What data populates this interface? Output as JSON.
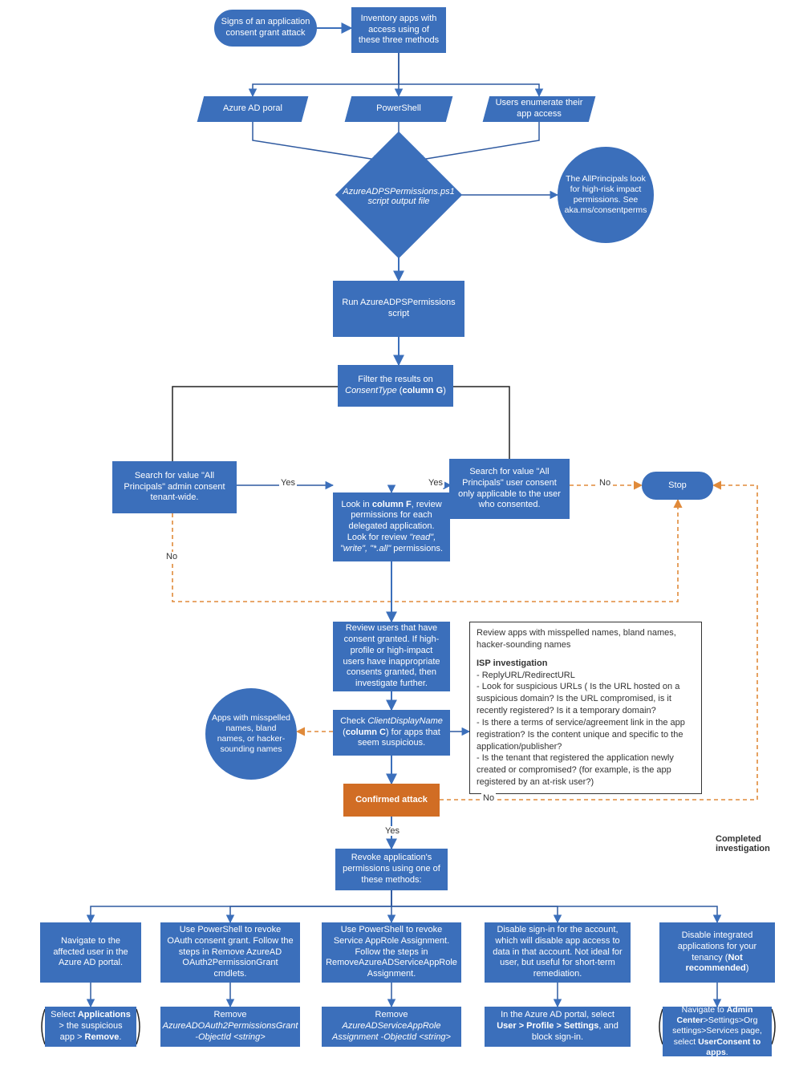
{
  "colors": {
    "primary": "#3b6fbb",
    "accent": "#d16d24",
    "dashed": "#e08a3a"
  },
  "nodes": {
    "start": "Signs of an application consent grant attack",
    "inventory": "Inventory apps with access using of these three methods",
    "azurePortal": "Azure AD poral",
    "powershell": "PowerShell",
    "usersEnum": "Users enumerate their app access",
    "scriptFile": "AzureADPSPermissions.ps1 script output file",
    "allPrincipalsNote": "The AllPrincipals look for high-risk impact permissions. See aka.ms/consentperms",
    "runScript": "Run AzureADPSPermissions script",
    "filter_pre": "Filter the results on ",
    "filter_em": "ConsentType",
    "filter_post": " (column G)",
    "searchAdmin": "Search for value \"All Principals\" admin consent tenant-wide.",
    "searchUser": "Search for value \"All Principals\" user consent only applicable to the user who consented.",
    "lookF_pre": "Look in ",
    "lookF_bold": "column F",
    "lookF_mid": ", review permissions for each delegated application. Look for review ",
    "lookF_perms": "\"read\", \"write\", \"*.all\"",
    "lookF_post": " permissions.",
    "reviewUsers": "Review users that have consent granted. If high-profile or high-impact users have inappropriate consents granted, then investigate further.",
    "checkClient_pre": "Check ",
    "checkClient_em": "ClientDisplayName",
    "checkClient_mid": " (",
    "checkClient_bold": "column C",
    "checkClient_post": ") for apps that seem suspicious.",
    "appsNamesCircle": "Apps with misspelled names, bland names, or hacker-sounding names",
    "confirmed": "Confirmed attack",
    "revoke": "Revoke application's permissions using one of these methods:",
    "m1": "Navigate to the affected user in the Azure AD portal.",
    "m1b_pre": "Select ",
    "m1b_b1": "Applications",
    "m1b_mid": " > the suspicious app > ",
    "m1b_b2": "Remove",
    "m1b_post": ".",
    "m2": "Use PowerShell to revoke OAuth consent grant. Follow the steps in Remove AzureAD OAuth2PermissionGrant cmdlets.",
    "m2b_pre": "Remove ",
    "m2b_em": "AzureADOAuth2PermissionsGrant -ObjectId <string>",
    "m3": "Use PowerShell to  revoke Service AppRole Assignment. Follow the steps in RemoveAzureADServiceAppRole Assignment.",
    "m3b_pre": "Remove ",
    "m3b_em": "AzureADServiceAppRole Assignment -ObjectId <string>",
    "m4": "Disable sign-in for the account, which will disable app access to data in that account. Not ideal for user, but useful for short-term remediation.",
    "m4b_pre": "In the Azure AD portal, select ",
    "m4b_bold": "User > Profile > Settings",
    "m4b_post": ", and block sign-in.",
    "m5_pre": "Disable integrated applications for your tenancy (",
    "m5_bold": "Not recommended",
    "m5_post": ")",
    "m5b_pre": "Navigate to ",
    "m5b_bold": "Admin Center",
    "m5b_mid": ">Settings>Org settings>Services page, select ",
    "m5b_b2": "UserConsent to apps",
    "m5b_post": ".",
    "reviewApps_header": "Review apps with misspelled names, bland names, hacker-sounding names",
    "isp_title": "ISP investigation",
    "isp_b1": "- ReplyURL/RedirectURL",
    "isp_b2": "- Look for suspicious URLs ( Is the URL hosted on a suspicious domain? Is the URL compromised, is it recently registered? Is it a temporary domain?",
    "isp_b3": "- Is there a terms of service/agreement link in the app registration? Is the content unique and specific to the application/publisher?",
    "isp_b4": " - Is the tenant that registered the application newly created or compromised? (for example, is the app registered by an at-risk user?)",
    "stop": "Stop",
    "yes": "Yes",
    "no": "No",
    "completed": "Completed investigation"
  }
}
